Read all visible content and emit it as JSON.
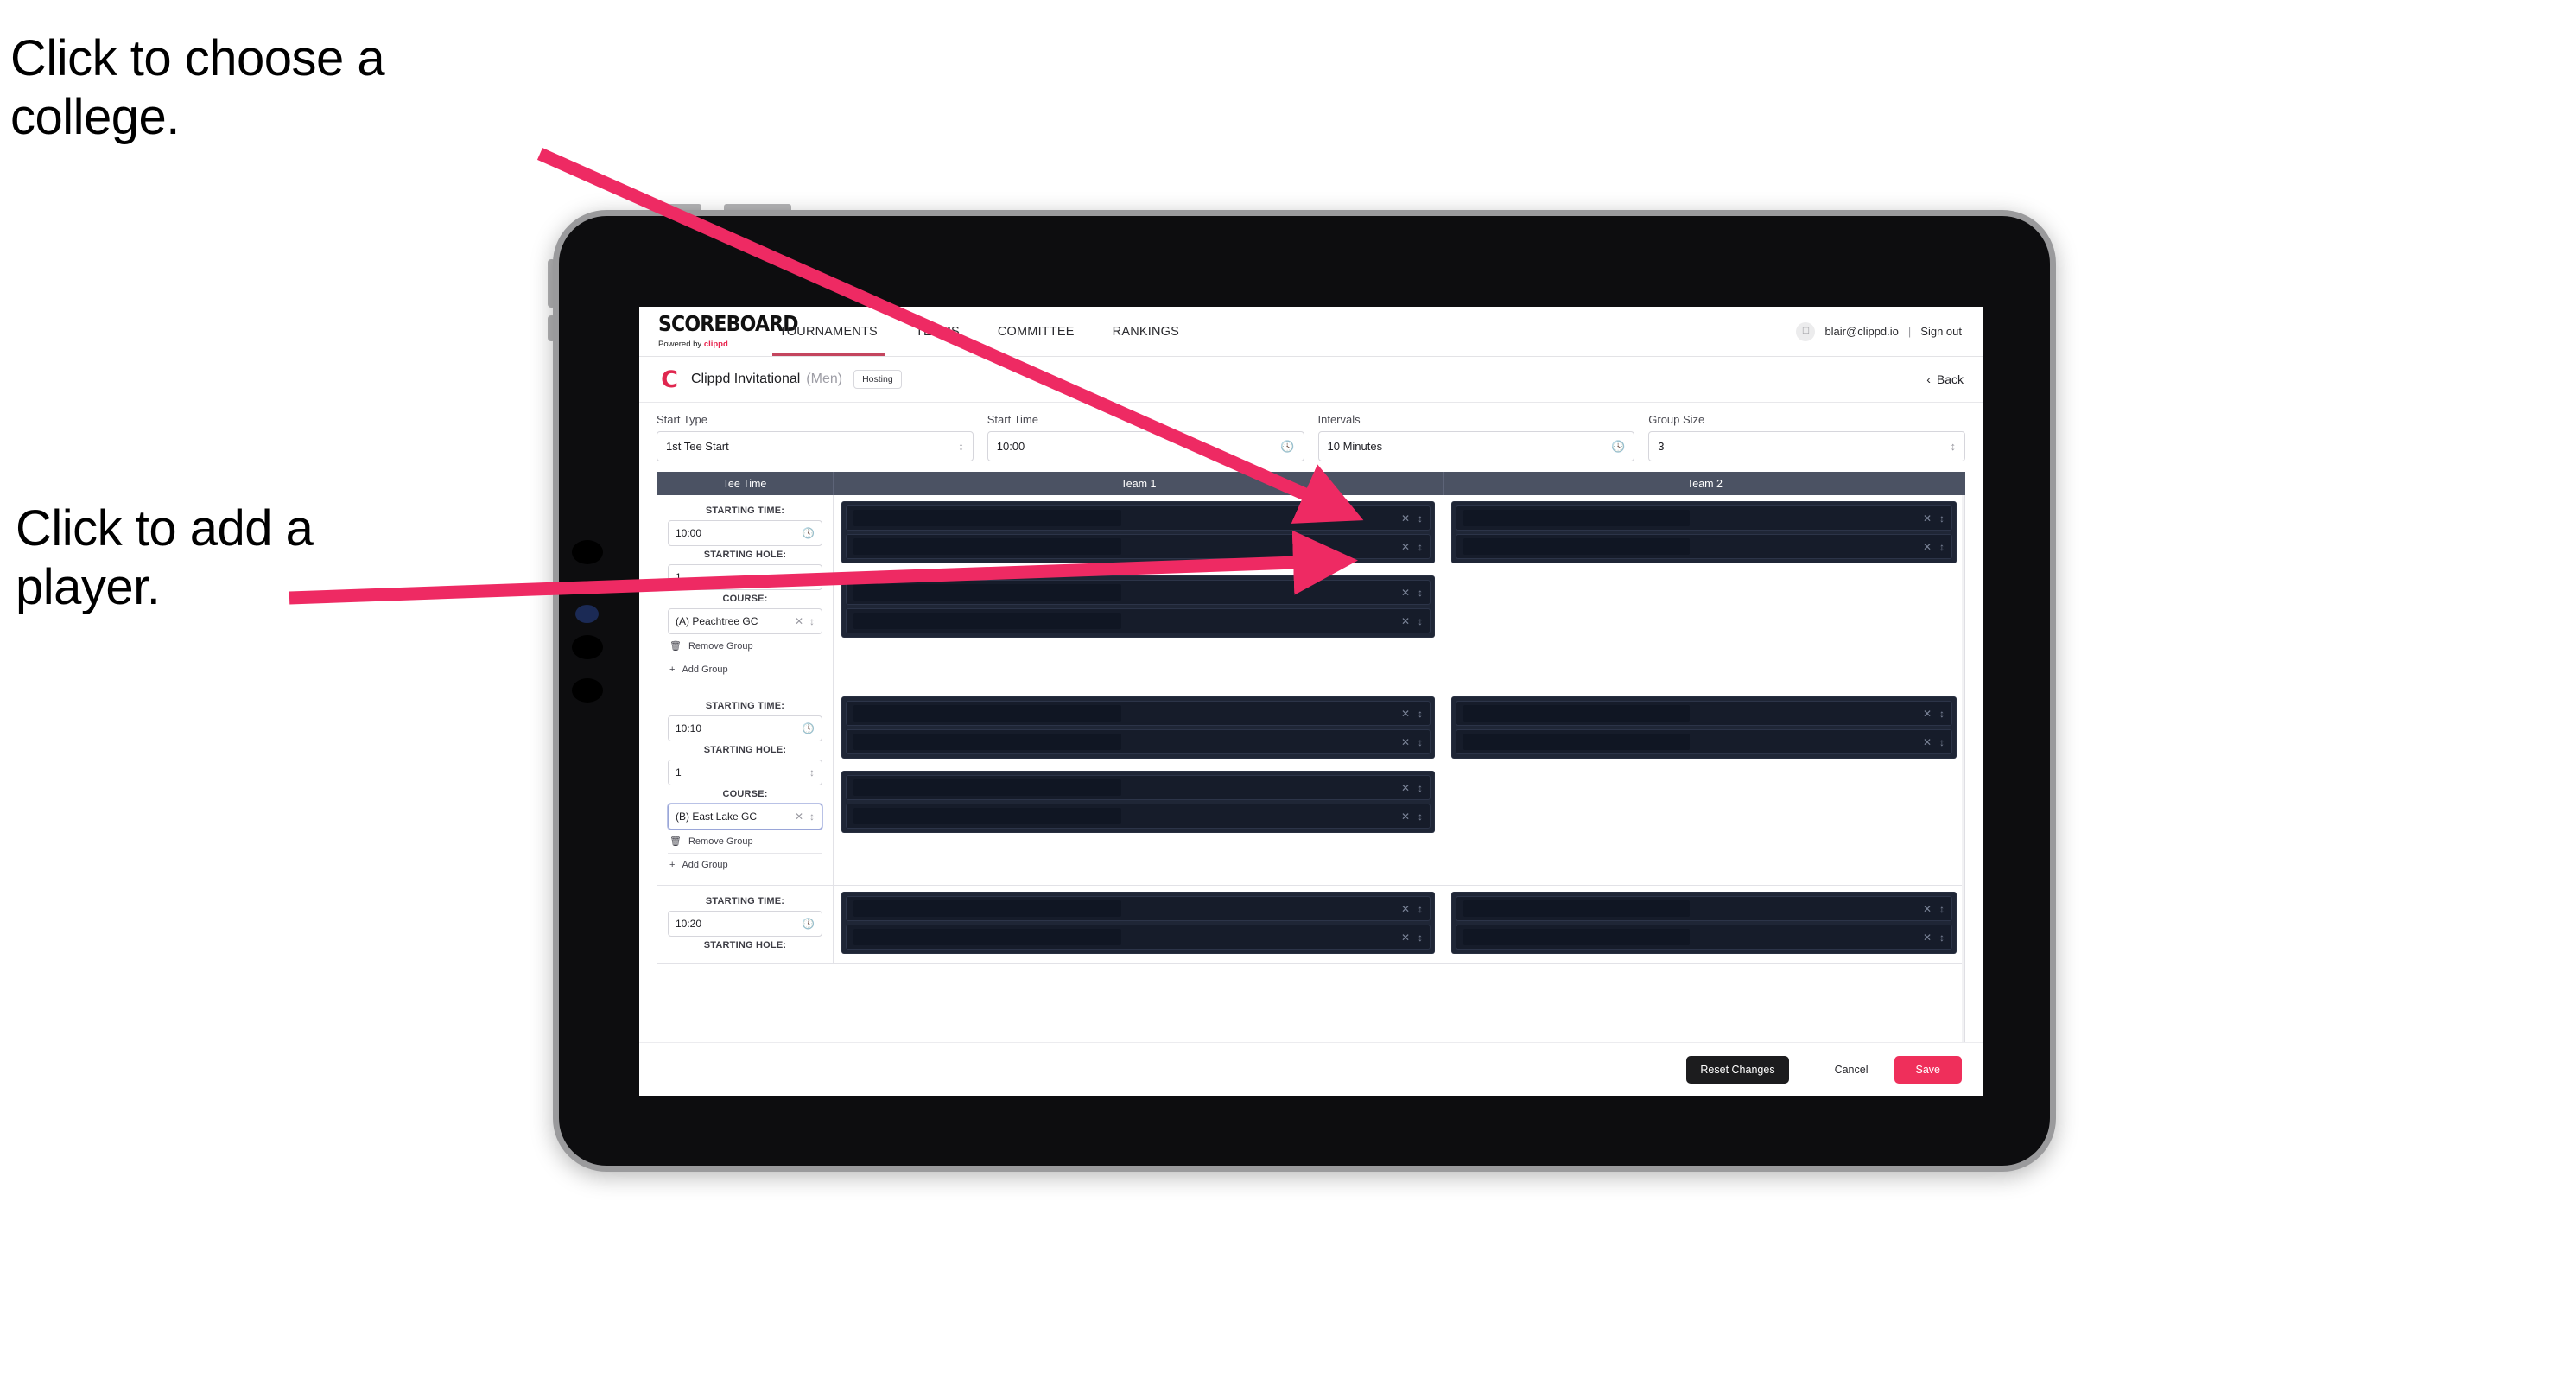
{
  "annotations": [
    {
      "id": "college",
      "text": "Click to choose a college."
    },
    {
      "id": "player",
      "text": "Click to add a player."
    }
  ],
  "colors": {
    "accent_pink": "#ef2f5b",
    "arrow_pink": "#ee2a63",
    "brand_red": "#e0274f",
    "table_header": "#4b5263",
    "dark_row": "#161c2a",
    "dark_group": "#1f2636"
  },
  "topnav": {
    "brand_title": "SCOREBOARD",
    "brand_sub_prefix": "Powered by ",
    "brand_sub_brand": "clippd",
    "tabs": [
      {
        "label": "TOURNAMENTS",
        "active": true
      },
      {
        "label": "TEAMS",
        "active": false
      },
      {
        "label": "COMMITTEE",
        "active": false
      },
      {
        "label": "RANKINGS",
        "active": false
      }
    ],
    "avatar_icon": "user-avatar-icon",
    "user_email": "blair@clippd.io",
    "separator": "|",
    "sign_out": "Sign out"
  },
  "titlebar": {
    "logo_letter": "C",
    "tournament_name": "Clippd Invitational",
    "gender": "(Men)",
    "badge": "Hosting",
    "back_chevron": "‹",
    "back_label": "Back"
  },
  "controls": [
    {
      "label": "Start Type",
      "value": "1st Tee Start",
      "icon": "stepper-icon"
    },
    {
      "label": "Start Time",
      "value": "10:00",
      "icon": "clock-icon"
    },
    {
      "label": "Intervals",
      "value": "10 Minutes",
      "icon": "clock-icon"
    },
    {
      "label": "Group Size",
      "value": "3",
      "icon": "stepper-icon"
    }
  ],
  "table": {
    "headers": [
      "Tee Time",
      "Team 1",
      "Team 2"
    ],
    "field_labels": {
      "starting_time": "STARTING TIME:",
      "starting_hole": "STARTING HOLE:",
      "course": "COURSE:"
    },
    "group_actions": {
      "remove": "Remove Group",
      "add": "Add Group",
      "remove_icon": "trash-icon",
      "add_icon": "plus-icon"
    },
    "rows": [
      {
        "starting_time": "10:00",
        "starting_hole": "1",
        "course": "(A) Peachtree GC",
        "course_focused": false,
        "team1_groups": [
          {
            "players": [
              {
                "redacted": true
              },
              {
                "redacted": true
              }
            ]
          },
          {
            "players": [
              {
                "redacted": true
              },
              {
                "redacted": true
              }
            ]
          }
        ],
        "team2_groups": [
          {
            "players": [
              {
                "redacted": true
              },
              {
                "redacted": true
              }
            ]
          }
        ]
      },
      {
        "starting_time": "10:10",
        "starting_hole": "1",
        "course": "(B) East Lake GC",
        "course_focused": true,
        "team1_groups": [
          {
            "players": [
              {
                "redacted": true
              },
              {
                "redacted": true
              }
            ]
          },
          {
            "players": [
              {
                "redacted": true
              },
              {
                "redacted": true
              }
            ]
          }
        ],
        "team2_groups": [
          {
            "players": [
              {
                "redacted": true
              },
              {
                "redacted": true
              }
            ]
          }
        ]
      },
      {
        "starting_time": "10:20",
        "starting_hole": "",
        "course": "",
        "course_focused": false,
        "team1_groups": [
          {
            "players": [
              {
                "redacted": true
              },
              {
                "redacted": true
              }
            ]
          }
        ],
        "team2_groups": [
          {
            "players": [
              {
                "redacted": true
              },
              {
                "redacted": true
              }
            ]
          }
        ]
      }
    ],
    "row_icons": {
      "clear": "clear-x-icon",
      "stepper": "stepper-icon",
      "clock": "clock-icon"
    }
  },
  "footer": {
    "reset": "Reset Changes",
    "cancel": "Cancel",
    "save": "Save"
  }
}
